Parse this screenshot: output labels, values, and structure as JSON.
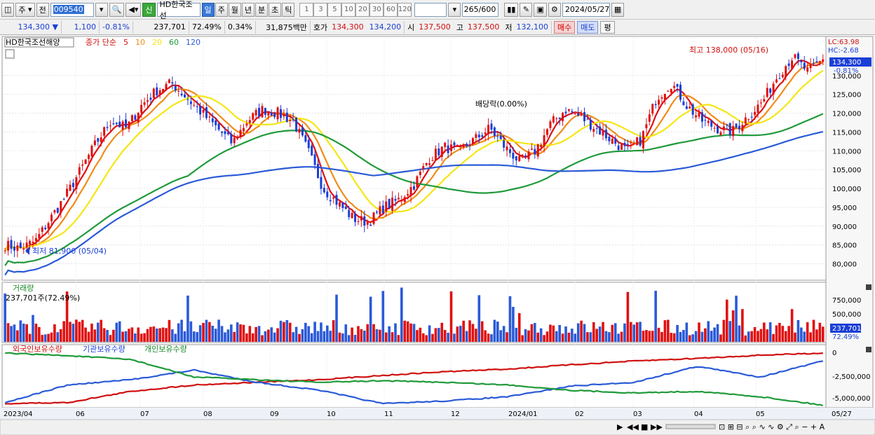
{
  "toolbar": {
    "market": "주",
    "prev": "전",
    "code": "009540",
    "shin_badge": "신",
    "stock_name": "HD한국조선",
    "periods": [
      "일",
      "주",
      "월",
      "년",
      "분",
      "초",
      "틱"
    ],
    "selected_period": "일",
    "intervals": [
      "1",
      "3",
      "5",
      "10",
      "20",
      "30",
      "60",
      "120"
    ],
    "count": "265",
    "count_total": "/600",
    "date": "2024/05/27"
  },
  "info": {
    "price": "134,300",
    "change": "1,100",
    "change_pct": "-0.81%",
    "volume": "237,701",
    "vol_ratio": "72.49%",
    "turnover": "0.34%",
    "amount": "31,875백만",
    "hoga_label": "호가",
    "ask": "134,300",
    "bid": "134,200",
    "open_label": "시",
    "open": "137,500",
    "high_label": "고",
    "high": "137,500",
    "low_label": "저",
    "low": "132,100",
    "buy_btn": "매수",
    "sell_btn": "매도",
    "eval_btn": "평"
  },
  "price_panel": {
    "stock_label": "HD한국조선해양",
    "ma_title": "종가 단순",
    "ma_periods": [
      "5",
      "10",
      "20",
      "60",
      "120"
    ],
    "ma_colors": [
      "#e01010",
      "#f08c1a",
      "#f5e614",
      "#1f9a3a",
      "#2a5ad8"
    ],
    "lc": "LC:63.98",
    "hc": "HC:-2.68",
    "cur_price": "134,300",
    "cur_pct": "-0.81%",
    "high_marker": "최고 138,000 (05/16)",
    "low_marker": "최저 81,900 (05/04)",
    "dividend": "배당락(0.00%)",
    "y_ticks": [
      "130,000",
      "125,000",
      "120,000",
      "115,000",
      "110,000",
      "105,000",
      "100,000",
      "95,000",
      "90,000",
      "85,000",
      "80,000"
    ]
  },
  "volume_panel": {
    "title": "거래량",
    "value": "237,701주(72.49%)",
    "y_ticks": [
      "750,000",
      "500,000"
    ],
    "cur_vol": "237,701",
    "cur_pct": "72.49%"
  },
  "holdings_panel": {
    "foreign": "외국인보유수량",
    "institution": "기관보유수량",
    "individual": "개인보유수량",
    "y_ticks": [
      "0",
      "-2,500,000",
      "-5,000,000"
    ]
  },
  "x_axis": [
    "2023/04",
    "06",
    "07",
    "08",
    "09",
    "10",
    "11",
    "12",
    "2024/01",
    "02",
    "03",
    "04",
    "05",
    "05/27"
  ],
  "chart_data": {
    "type": "candlestick",
    "title": "HD한국조선해양",
    "ylim": [
      76000,
      140000
    ],
    "approx_closes": [
      85000,
      84000,
      86000,
      92000,
      98000,
      105000,
      112000,
      118000,
      116000,
      122000,
      126000,
      128000,
      124000,
      120000,
      116000,
      112000,
      118000,
      121000,
      120000,
      118000,
      110000,
      100000,
      96000,
      92000,
      91000,
      95000,
      97000,
      101000,
      108000,
      111000,
      110000,
      113000,
      116000,
      111000,
      107000,
      110000,
      117000,
      121000,
      119000,
      116000,
      113000,
      110000,
      113000,
      124000,
      128000,
      122000,
      118000,
      116000,
      115000,
      119000,
      123000,
      130000,
      135000,
      131000,
      134300
    ]
  }
}
